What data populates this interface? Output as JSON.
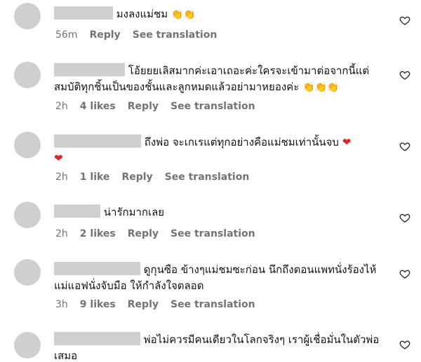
{
  "comments": [
    {
      "text": "มงลงแม่ชม",
      "emoji": "👏👏",
      "meta": {
        "time": "56m",
        "likes": "",
        "reply": "Reply",
        "see": "See translation"
      }
    },
    {
      "text": "โอ้ยยยเลิสมากค่ะเอาเถอะค่ะใครจะเข้ามาต่อจากนี้แต่สมบัติทุกชิ้นเป็นของชั้นและลูกหมดแล้วอย่ามาหยองค่ะ",
      "emoji": "👏👏👏",
      "meta": {
        "time": "2h",
        "likes": "4 likes",
        "reply": "Reply",
        "see": "See translation"
      }
    },
    {
      "text": "ถึงพ่อ จะเกเรแต่ทุกอย่างคือแม่ชมเท่านั้นจบ",
      "emoji": "❤",
      "emoji2": "❤",
      "meta": {
        "time": "2h",
        "likes": "1 like",
        "reply": "Reply",
        "see": "See translation"
      }
    },
    {
      "text": "น่ารักมากเลย",
      "emoji": "",
      "meta": {
        "time": "2h",
        "likes": "2 likes",
        "reply": "Reply",
        "see": "See translation"
      }
    },
    {
      "text": "ดูกุนซือ ข้างๆแม่ชมซะก่อน นึกถึงตอนแพทนั่งร้องไห้แม่แอฟนั่งจับมือ ให้กำลังใจตลอด",
      "emoji": "",
      "meta": {
        "time": "3h",
        "likes": "9 likes",
        "reply": "Reply",
        "see": "See translation"
      }
    },
    {
      "text": "พ่อไม่ควรมีคนเดียวในโลกจริงๆ เราผู้เชื่อมั่นในตัวพ่อเสมอ",
      "emoji": "",
      "meta": {
        "time": "",
        "likes": "",
        "reply": "",
        "see": ""
      }
    }
  ],
  "icons": {
    "like": "heart-outline-icon",
    "clap": "clapping-hands-emoji",
    "red_heart": "red-heart-emoji"
  }
}
